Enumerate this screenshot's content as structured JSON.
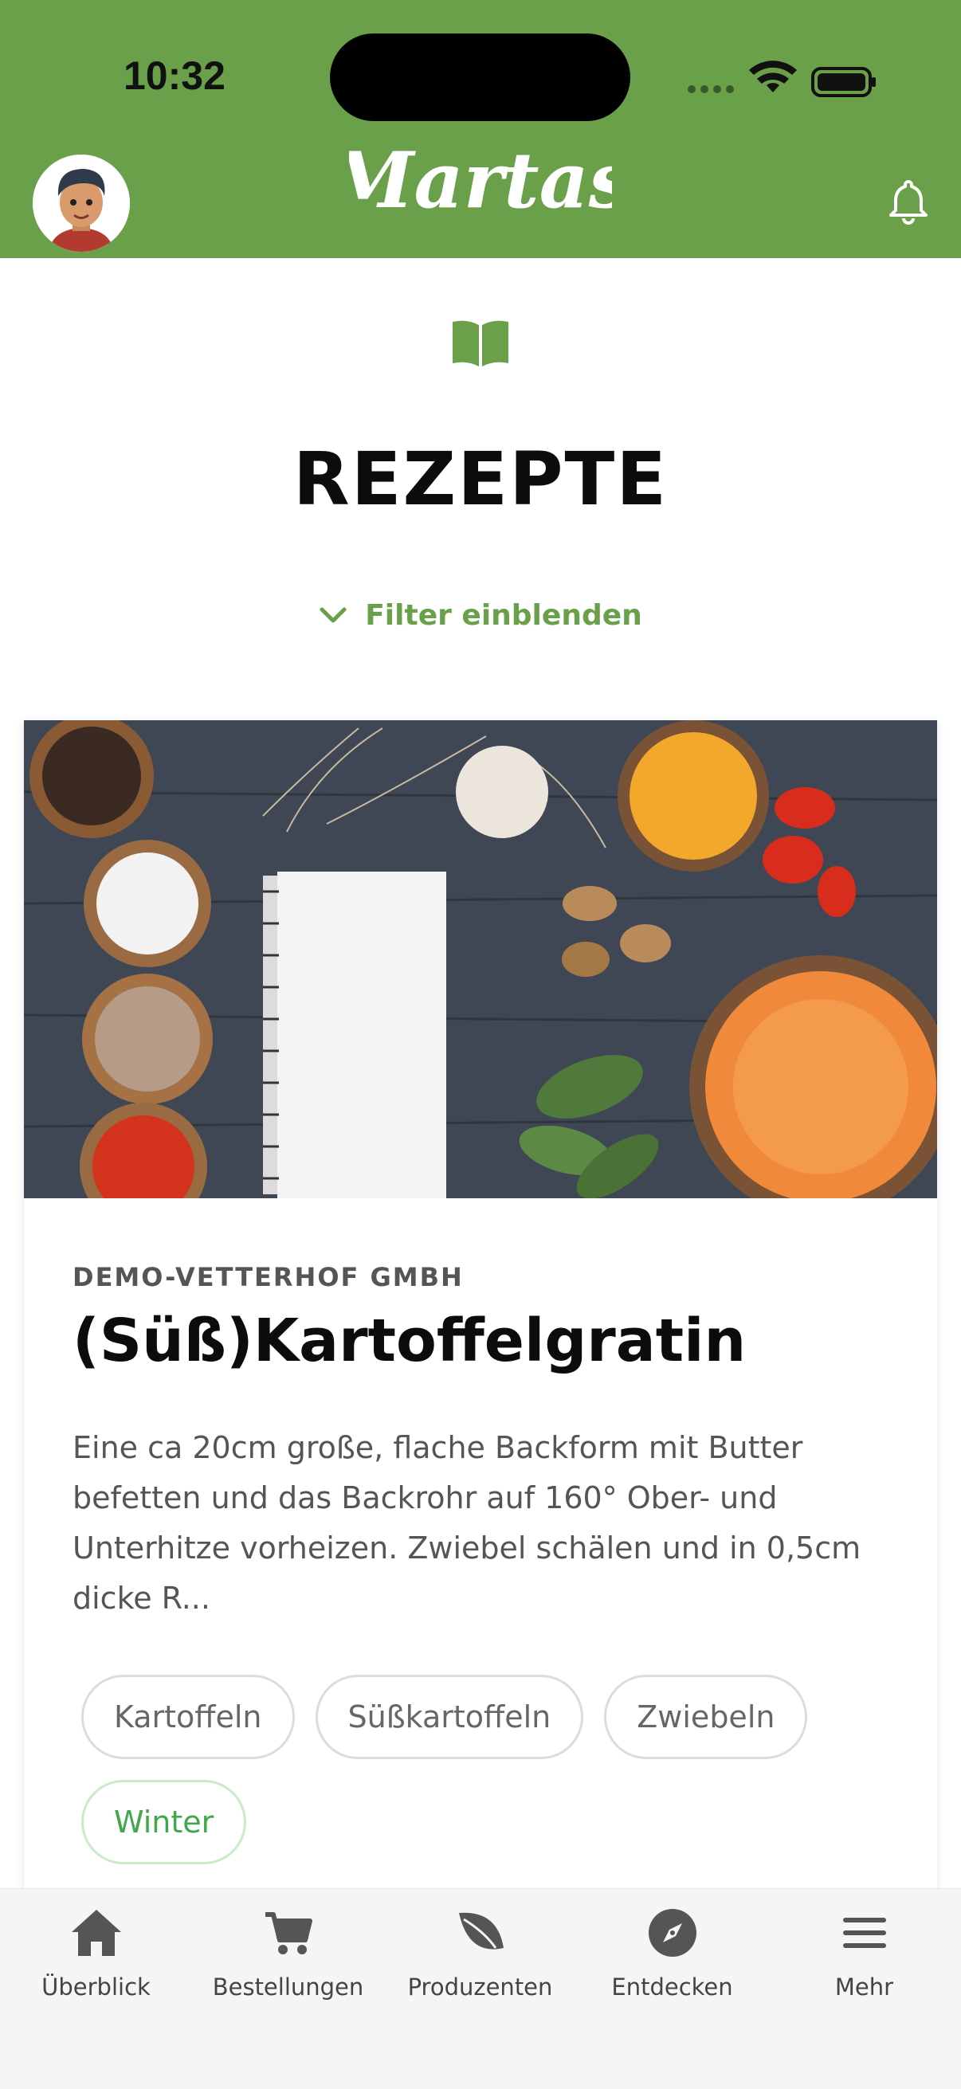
{
  "status_bar": {
    "time": "10:32"
  },
  "header": {
    "brand": "Martas",
    "avatar": "avatar-icon",
    "notification_icon": "bell-icon"
  },
  "page": {
    "icon": "book-icon",
    "title": "REZEPTE",
    "filter_label": "Filter einblenden"
  },
  "recipe_card": {
    "producer": "DEMO-VETTERHOF GMBH",
    "title": "(Süß)Kartoffelgratin",
    "description": "Eine ca 20cm große, flache Backform mit Butter befetten und das Backrohr auf 160° Ober- und Unterhitze vorheizen. Zwiebel schälen und in 0,5cm dicke R...",
    "tags": [
      "Kartoffeln",
      "Süßkartoffeln",
      "Zwiebeln"
    ],
    "highlight_tag": "Winter"
  },
  "bottom_nav": {
    "items": [
      {
        "label": "Überblick",
        "icon": "home-icon"
      },
      {
        "label": "Bestellungen",
        "icon": "cart-icon"
      },
      {
        "label": "Produzenten",
        "icon": "leaf-icon"
      },
      {
        "label": "Entdecken",
        "icon": "compass-icon"
      },
      {
        "label": "Mehr",
        "icon": "menu-icon"
      }
    ]
  },
  "colors": {
    "brand_green": "#69a049",
    "tag_green": "#3fa84a",
    "nav_bg": "#f5f5f5"
  }
}
